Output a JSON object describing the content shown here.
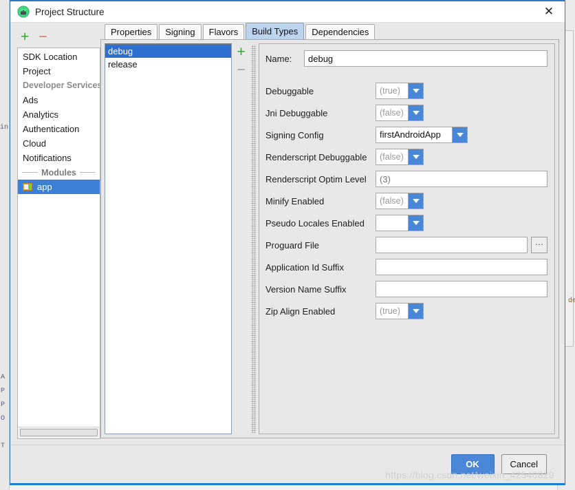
{
  "window": {
    "title": "Project Structure",
    "icon": "android-studio-icon",
    "close_label": "✕"
  },
  "sidebar": {
    "add_label": "+",
    "remove_label": "−",
    "items": [
      {
        "label": "SDK Location",
        "type": "item"
      },
      {
        "label": "Project",
        "type": "item"
      },
      {
        "label": "Developer Services",
        "type": "header"
      },
      {
        "label": "Ads",
        "type": "item"
      },
      {
        "label": "Analytics",
        "type": "item"
      },
      {
        "label": "Authentication",
        "type": "item"
      },
      {
        "label": "Cloud",
        "type": "item"
      },
      {
        "label": "Notifications",
        "type": "item"
      },
      {
        "label": "Modules",
        "type": "separator"
      },
      {
        "label": "app",
        "type": "module",
        "selected": true
      }
    ]
  },
  "tabs": [
    {
      "label": "Properties",
      "active": false
    },
    {
      "label": "Signing",
      "active": false
    },
    {
      "label": "Flavors",
      "active": false
    },
    {
      "label": "Build Types",
      "active": true
    },
    {
      "label": "Dependencies",
      "active": false
    }
  ],
  "build_types": {
    "add_label": "+",
    "remove_label": "−",
    "items": [
      {
        "label": "debug",
        "selected": true
      },
      {
        "label": "release",
        "selected": false
      }
    ]
  },
  "form": {
    "name_label": "Name:",
    "name_value": "debug",
    "fields": [
      {
        "label": "Debuggable",
        "kind": "combo",
        "value": "(true)",
        "muted": true
      },
      {
        "label": "Jni Debuggable",
        "kind": "combo",
        "value": "(false)",
        "muted": true
      },
      {
        "label": "Signing Config",
        "kind": "combo-wide",
        "value": "firstAndroidApp",
        "muted": false
      },
      {
        "label": "Renderscript Debuggable",
        "kind": "combo",
        "value": "(false)",
        "muted": true
      },
      {
        "label": "Renderscript Optim Level",
        "kind": "text-full",
        "value": "",
        "placeholder": "(3)"
      },
      {
        "label": "Minify Enabled",
        "kind": "combo",
        "value": "(false)",
        "muted": true
      },
      {
        "label": "Pseudo Locales Enabled",
        "kind": "combo",
        "value": "",
        "muted": true
      },
      {
        "label": "Proguard File",
        "kind": "text-browse",
        "value": "",
        "placeholder": "",
        "browse_label": "⋯"
      },
      {
        "label": "Application Id Suffix",
        "kind": "text-full",
        "value": "",
        "placeholder": ""
      },
      {
        "label": "Version Name Suffix",
        "kind": "text-full",
        "value": "",
        "placeholder": ""
      },
      {
        "label": "Zip Align Enabled",
        "kind": "combo",
        "value": "(true)",
        "muted": true
      }
    ]
  },
  "footer": {
    "ok_label": "OK",
    "cancel_label": "Cancel"
  },
  "watermark": "https://blog.csdn.net/weixin_42540829",
  "background": {
    "fragments": [
      "A",
      "P",
      "P",
      "O",
      "T",
      "in",
      "de"
    ]
  },
  "colors": {
    "accent": "#4a87d8",
    "selection": "#2f6fd0",
    "tab_active": "#bdd4ef",
    "window_border": "#2f79c4",
    "add_green": "#3f9c41",
    "remove_red": "#d96a62"
  }
}
